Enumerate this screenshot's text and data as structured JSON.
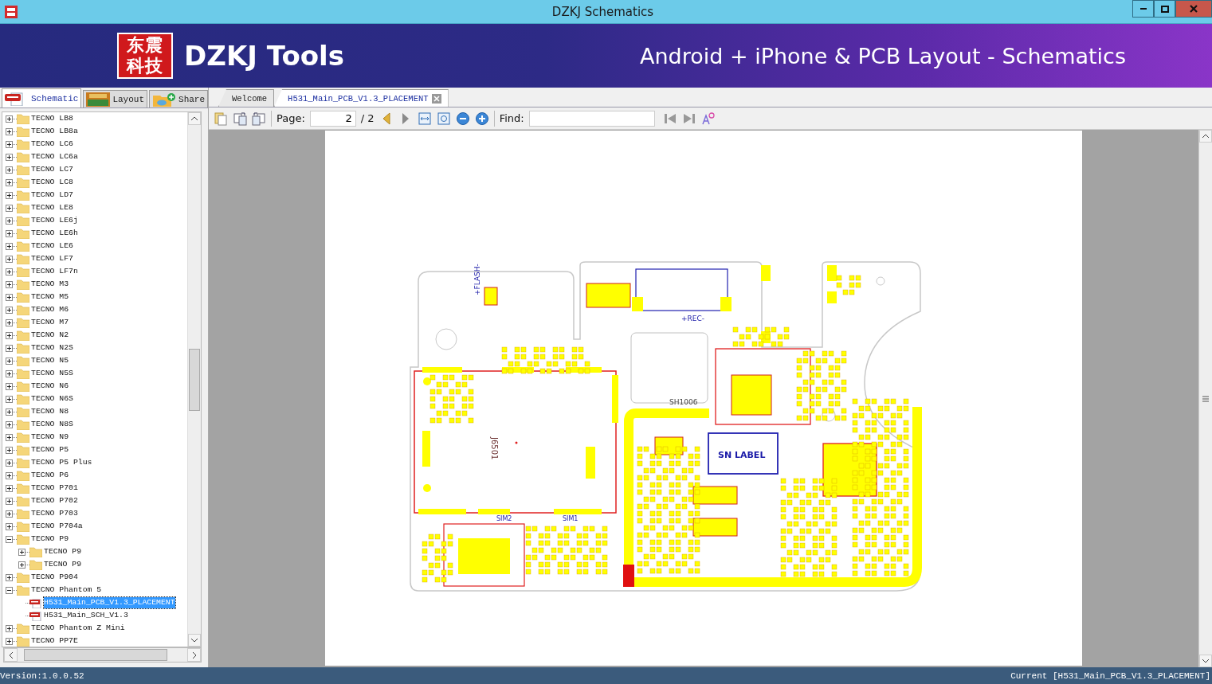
{
  "window": {
    "title": "DZKJ Schematics"
  },
  "banner": {
    "logo_lines": [
      "东震",
      "科技"
    ],
    "brand": "DZKJ Tools",
    "tagline": "Android + iPhone & PCB Layout - Schematics"
  },
  "side_tabs": [
    {
      "label": "Schematic",
      "kind": "pdf",
      "selected": true
    },
    {
      "label": "Layout",
      "kind": "pads",
      "selected": false
    },
    {
      "label": "Share",
      "kind": "share",
      "selected": false
    }
  ],
  "tree": {
    "items": [
      {
        "label": "TECNO LB8",
        "kind": "folder",
        "expanded": false,
        "selected": false
      },
      {
        "label": "TECNO LB8a",
        "kind": "folder",
        "expanded": false,
        "selected": false
      },
      {
        "label": "TECNO LC6",
        "kind": "folder",
        "expanded": false,
        "selected": false
      },
      {
        "label": "TECNO LC6a",
        "kind": "folder",
        "expanded": false,
        "selected": false
      },
      {
        "label": "TECNO LC7",
        "kind": "folder",
        "expanded": false,
        "selected": false
      },
      {
        "label": "TECNO LC8",
        "kind": "folder",
        "expanded": false,
        "selected": false
      },
      {
        "label": "TECNO LD7",
        "kind": "folder",
        "expanded": false,
        "selected": false
      },
      {
        "label": "TECNO LE8",
        "kind": "folder",
        "expanded": false,
        "selected": false
      },
      {
        "label": "TECNO LE6j",
        "kind": "folder",
        "expanded": false,
        "selected": false
      },
      {
        "label": "TECNO LE6h",
        "kind": "folder",
        "expanded": false,
        "selected": false
      },
      {
        "label": "TECNO LE6",
        "kind": "folder",
        "expanded": false,
        "selected": false
      },
      {
        "label": "TECNO LF7",
        "kind": "folder",
        "expanded": false,
        "selected": false
      },
      {
        "label": "TECNO LF7n",
        "kind": "folder",
        "expanded": false,
        "selected": false
      },
      {
        "label": "TECNO M3",
        "kind": "folder",
        "expanded": false,
        "selected": false
      },
      {
        "label": "TECNO M5",
        "kind": "folder",
        "expanded": false,
        "selected": false
      },
      {
        "label": "TECNO M6",
        "kind": "folder",
        "expanded": false,
        "selected": false
      },
      {
        "label": "TECNO M7",
        "kind": "folder",
        "expanded": false,
        "selected": false
      },
      {
        "label": "TECNO N2",
        "kind": "folder",
        "expanded": false,
        "selected": false
      },
      {
        "label": "TECNO N2S",
        "kind": "folder",
        "expanded": false,
        "selected": false
      },
      {
        "label": "TECNO N5",
        "kind": "folder",
        "expanded": false,
        "selected": false
      },
      {
        "label": "TECNO N5S",
        "kind": "folder",
        "expanded": false,
        "selected": false
      },
      {
        "label": "TECNO N6",
        "kind": "folder",
        "expanded": false,
        "selected": false
      },
      {
        "label": "TECNO N6S",
        "kind": "folder",
        "expanded": false,
        "selected": false
      },
      {
        "label": "TECNO N8",
        "kind": "folder",
        "expanded": false,
        "selected": false
      },
      {
        "label": "TECNO N8S",
        "kind": "folder",
        "expanded": false,
        "selected": false
      },
      {
        "label": "TECNO N9",
        "kind": "folder",
        "expanded": false,
        "selected": false
      },
      {
        "label": "TECNO P5",
        "kind": "folder",
        "expanded": false,
        "selected": false
      },
      {
        "label": "TECNO P5 Plus",
        "kind": "folder",
        "expanded": false,
        "selected": false
      },
      {
        "label": "TECNO P6",
        "kind": "folder",
        "expanded": false,
        "selected": false
      },
      {
        "label": "TECNO P701",
        "kind": "folder",
        "expanded": false,
        "selected": false
      },
      {
        "label": "TECNO P702",
        "kind": "folder",
        "expanded": false,
        "selected": false
      },
      {
        "label": "TECNO P703",
        "kind": "folder",
        "expanded": false,
        "selected": false
      },
      {
        "label": "TECNO P704a",
        "kind": "folder",
        "expanded": false,
        "selected": false
      },
      {
        "label": "TECNO P9",
        "kind": "folder",
        "expanded": true,
        "selected": false,
        "children": [
          {
            "label": "TECNO P9",
            "kind": "folder",
            "expanded": false,
            "selected": false
          },
          {
            "label": "TECNO P9",
            "kind": "folder",
            "expanded": false,
            "selected": false
          }
        ]
      },
      {
        "label": "TECNO P904",
        "kind": "folder",
        "expanded": false,
        "selected": false
      },
      {
        "label": "TECNO Phantom 5",
        "kind": "folder",
        "expanded": true,
        "selected": false,
        "children": [
          {
            "label": "H531_Main_PCB_V1.3_PLACEMENT",
            "kind": "pdf",
            "selected": true
          },
          {
            "label": "H531_Main_SCH_V1.3",
            "kind": "pdf",
            "selected": false
          }
        ]
      },
      {
        "label": "TECNO Phantom Z Mini",
        "kind": "folder",
        "expanded": false,
        "selected": false
      },
      {
        "label": "TECNO PP7E",
        "kind": "folder",
        "expanded": false,
        "selected": false
      }
    ]
  },
  "doc_tabs": [
    {
      "label": "Welcome",
      "selected": false,
      "closable": false
    },
    {
      "label": "H531_Main_PCB_V1.3_PLACEMENT",
      "selected": true,
      "closable": true
    }
  ],
  "toolbar": {
    "page_label": "Page:",
    "page_value": "2",
    "page_total": "/ 2",
    "find_label": "Find:"
  },
  "pcb": {
    "labels": [
      "+FLASH-",
      "+REC-",
      "SH1006",
      "J6501",
      "SN LABEL",
      "SIM2",
      "SIM1"
    ]
  },
  "status_bar": {
    "version": "Version:1.0.0.52",
    "current": "Current [H531_Main_PCB_V1.3_PLACEMENT]"
  }
}
